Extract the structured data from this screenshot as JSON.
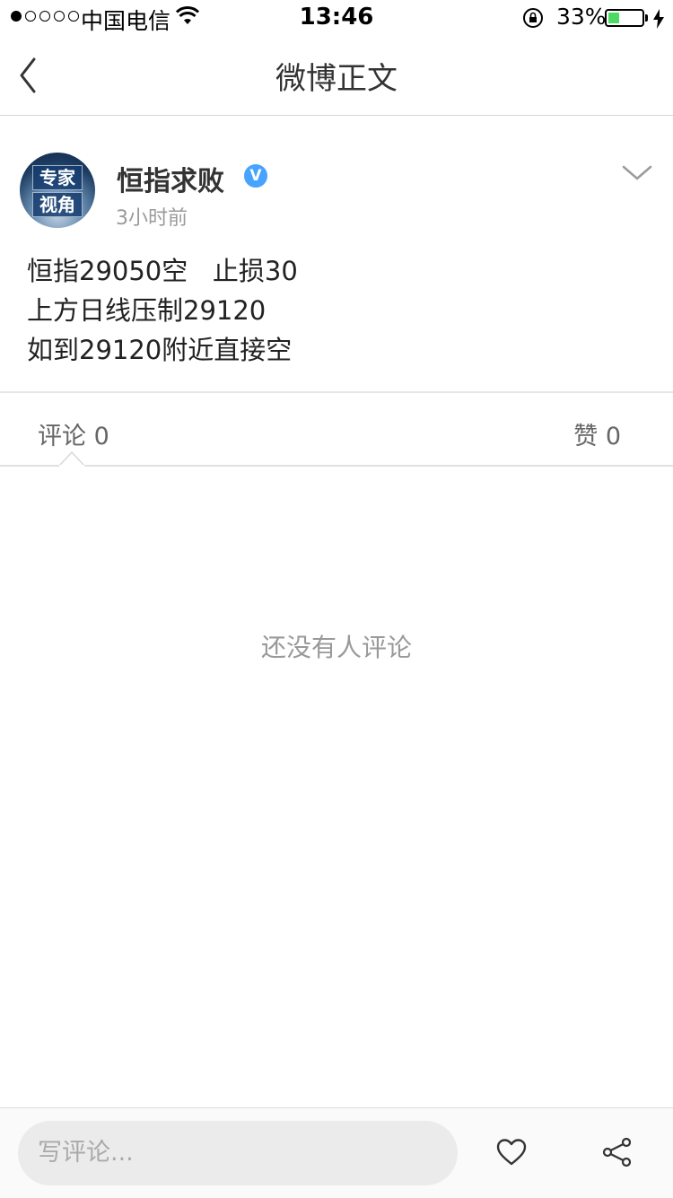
{
  "status_bar": {
    "carrier": "中国电信",
    "time": "13:46",
    "battery_percent": "33%",
    "battery_level": 0.33,
    "signal_bars": 1
  },
  "nav": {
    "title": "微博正文",
    "back_icon": "chevron-left-icon"
  },
  "post": {
    "author": "恒指求败",
    "verified_icon": "verified-v-icon",
    "time_ago": "3小时前",
    "avatar_text_line1": "专家",
    "avatar_text_line2": "视角",
    "lines": [
      "恒指29050空   止损30",
      "上方日线压制29120",
      "如到29120附近直接空"
    ]
  },
  "tabs": {
    "comments": "评论 0",
    "likes": "赞 0"
  },
  "empty_state": "还没有人评论",
  "bottom_bar": {
    "comment_placeholder": "写评论...",
    "like_icon": "heart-icon",
    "share_icon": "share-icon"
  }
}
